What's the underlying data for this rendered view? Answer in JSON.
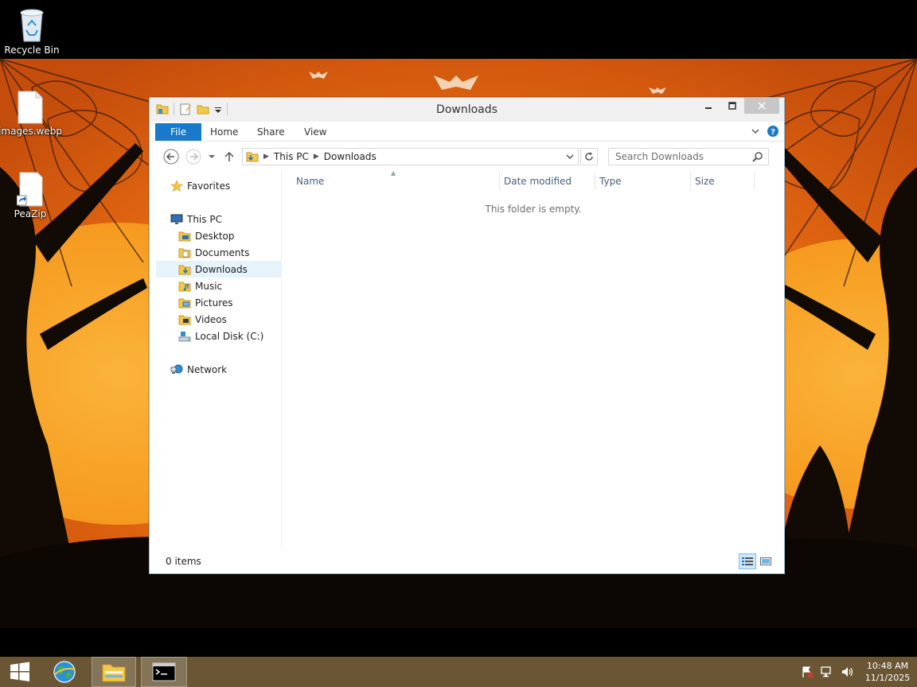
{
  "desktop": {
    "icons": [
      {
        "label": "Recycle Bin",
        "icon": "recycle-bin-icon"
      },
      {
        "label": "images.webp",
        "icon": "file-icon"
      },
      {
        "label": "PeaZip",
        "icon": "shortcut-file-icon"
      }
    ]
  },
  "window": {
    "title": "Downloads",
    "ribbon_tabs": [
      "File",
      "Home",
      "Share",
      "View"
    ],
    "address": {
      "crumbs": [
        "This PC",
        "Downloads"
      ]
    },
    "search": {
      "placeholder": "Search Downloads"
    },
    "nav": {
      "favorites": "Favorites",
      "this_pc": "This PC",
      "items": [
        "Desktop",
        "Documents",
        "Downloads",
        "Music",
        "Pictures",
        "Videos",
        "Local Disk (C:)"
      ],
      "selected": "Downloads",
      "network": "Network"
    },
    "columns": [
      "Name",
      "Date modified",
      "Type",
      "Size"
    ],
    "empty_message": "This folder is empty.",
    "status": {
      "count": "0 items"
    }
  },
  "taskbar": {
    "clock": {
      "time": "10:48 AM",
      "date": "11/1/2025"
    }
  },
  "colors": {
    "file_tab": "#1979ca",
    "taskbar": "#6a5634",
    "wallpaper_orange": "#e96d13",
    "selection": "#e5f3fb"
  }
}
